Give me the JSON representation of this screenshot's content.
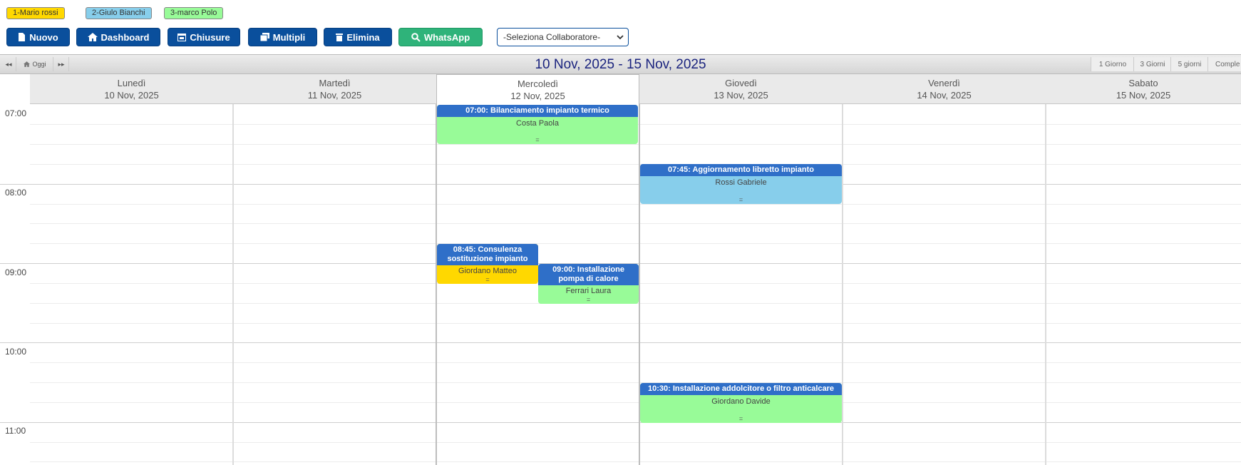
{
  "legend": [
    {
      "label": "1-Mario rossi",
      "color": "#ffd800"
    },
    {
      "label": "2-Giulo Bianchi",
      "color": "#87ceeb"
    },
    {
      "label": "3-marco Polo",
      "color": "#98fb98"
    }
  ],
  "toolbar": {
    "nuovo": "Nuovo",
    "dashboard": "Dashboard",
    "chiusure": "Chiusure",
    "multipli": "Multipli",
    "elimina": "Elimina",
    "whatsapp": "WhatsApp",
    "collaboratore_select": "-Seleziona Collaboratore-"
  },
  "calendar": {
    "title": "10 Nov, 2025 - 15 Nov, 2025",
    "nav": {
      "prev": "◂◂",
      "today": "Oggi",
      "next": "▸▸"
    },
    "views": [
      "1 Giorno",
      "3 Giorni",
      "5 giorni",
      "Comple"
    ],
    "days": [
      {
        "name": "Lunedì",
        "date": "10 Nov, 2025"
      },
      {
        "name": "Martedì",
        "date": "11 Nov, 2025"
      },
      {
        "name": "Mercoledì",
        "date": "12 Nov, 2025"
      },
      {
        "name": "Giovedì",
        "date": "13 Nov, 2025"
      },
      {
        "name": "Venerdì",
        "date": "14 Nov, 2025"
      },
      {
        "name": "Sabato",
        "date": "15 Nov, 2025"
      }
    ],
    "hours": [
      "07:00",
      "08:00",
      "09:00",
      "10:00",
      "11:00"
    ],
    "events": [
      {
        "title": "07:00: Bilanciamento impianto termico",
        "client": "Costa Paola",
        "color": "#98fb98",
        "grip": "="
      },
      {
        "title": "07:45: Aggiornamento libretto impianto",
        "client": "Rossi Gabriele",
        "color": "#87ceeb",
        "grip": "="
      },
      {
        "title": "08:45: Consulenza sostituzione impianto",
        "client": "Giordano Matteo",
        "color": "#ffd800",
        "grip": "="
      },
      {
        "title": "09:00: Installazione pompa di calore",
        "client": "Ferrari Laura",
        "color": "#98fb98",
        "grip": "="
      },
      {
        "title": "10:30: Installazione addolcitore o filtro anticalcare",
        "client": "Giordano Davide",
        "color": "#98fb98",
        "grip": "="
      }
    ]
  }
}
